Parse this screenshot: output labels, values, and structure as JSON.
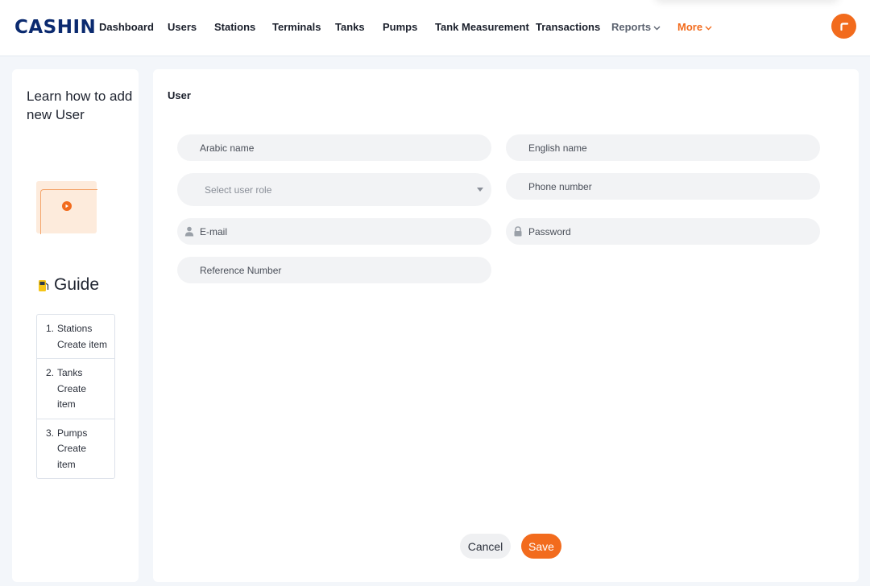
{
  "header": {
    "logo": "CASHIN",
    "nav": [
      {
        "label": "Dashboard",
        "name": "nav-dashboard"
      },
      {
        "label": "Users",
        "name": "nav-users"
      },
      {
        "label": "Stations",
        "name": "nav-stations"
      },
      {
        "label": "Terminals",
        "name": "nav-terminals"
      },
      {
        "label": "Tanks",
        "name": "nav-tanks"
      },
      {
        "label": "Pumps",
        "name": "nav-pumps"
      },
      {
        "label": "Tank Measurement",
        "name": "nav-tank-measurement"
      },
      {
        "label": "Transactions",
        "name": "nav-transactions"
      }
    ],
    "reports_label": "Reports",
    "more_label": "More",
    "avatar_icon": "cashin-c-logo-icon"
  },
  "guide": {
    "learn_title": "Learn how to add new User",
    "video_icon": "play-icon",
    "heading": "Guide",
    "heading_icon": "fuel-pump-icon",
    "items": [
      {
        "num": "1.",
        "title": "Stations",
        "action": "Create item"
      },
      {
        "num": "2.",
        "title": "Tanks",
        "action": "Create item"
      },
      {
        "num": "3.",
        "title": "Pumps",
        "action": "Create item"
      }
    ]
  },
  "form": {
    "title": "User",
    "arabic_name_placeholder": "Arabic name",
    "english_name_placeholder": "English name",
    "role_placeholder": "Select user role",
    "phone_placeholder": "Phone number",
    "email_placeholder": "E-mail",
    "email_icon": "user-icon",
    "password_placeholder": "Password",
    "password_icon": "lock-icon",
    "reference_placeholder": "Reference Number",
    "cancel_label": "Cancel",
    "save_label": "Save"
  },
  "colors": {
    "brand_navy": "#0b2a6f",
    "accent_orange": "#f26b1d",
    "field_bg": "#f2f3f5",
    "page_bg": "#f3f6fa"
  }
}
